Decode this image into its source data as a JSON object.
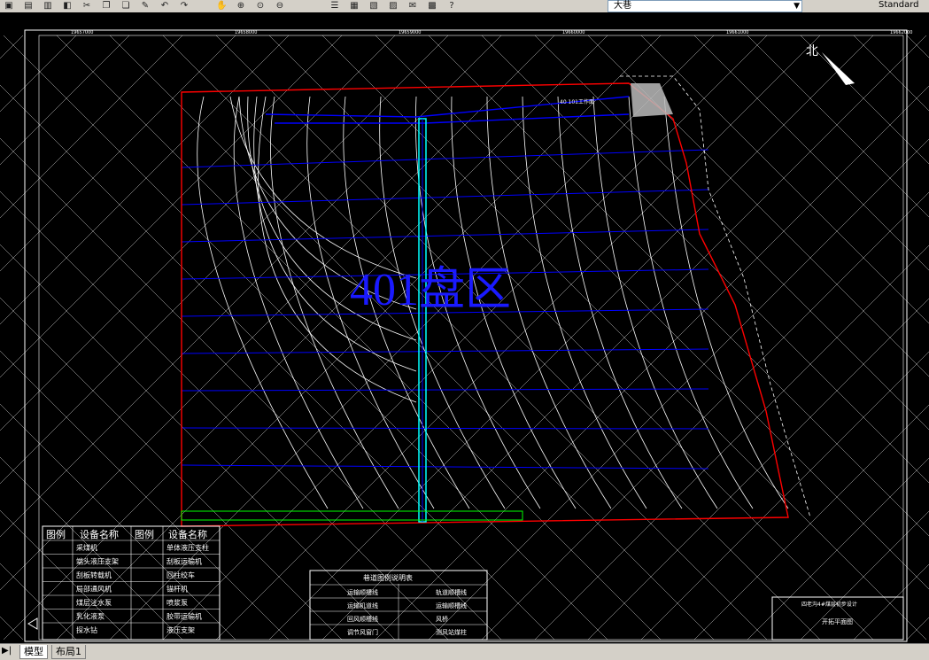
{
  "toolbar": {
    "icons": [
      "open-icon",
      "save-icon",
      "plot-icon",
      "preview-icon",
      "cut-icon",
      "copy-icon",
      "paste-icon",
      "matchprop-icon",
      "undo-icon",
      "redo-icon",
      "pan-icon",
      "zoom-realtime-icon",
      "zoom-window-icon",
      "zoom-previous-icon",
      "properties-icon",
      "designcenter-icon",
      "toolpalette-icon",
      "sheetset-icon",
      "markup-icon",
      "calculator-icon",
      "help-icon"
    ],
    "layer_name": "大巷",
    "style_name": "Standard"
  },
  "drawing": {
    "watermark": "401盘区",
    "north_label": "北",
    "coord_labels_top": [
      "19657000",
      "19658000",
      "19659000",
      "19660000",
      "19661000",
      "19662000"
    ],
    "legend_headers": [
      "图例",
      "设备名称",
      "图例",
      "设备名称"
    ],
    "legend_left": [
      "采煤机",
      "端头液压支架",
      "刮板转载机",
      "局部通风机",
      "煤层注水泵",
      "乳化液泵",
      "探水钻"
    ],
    "legend_right": [
      "单体液压支柱",
      "刮板运输机",
      "回柱绞车",
      "锚杆机",
      "喷浆泵",
      "胶带运输机",
      "液压支架"
    ],
    "table2_title": "巷道图例说明表",
    "table2_rows": [
      [
        "运输顺槽线",
        "轨道顺槽线"
      ],
      [
        "运输机道线",
        "运输顺槽线"
      ],
      [
        "回风顺槽线",
        "风桥"
      ],
      [
        "调节风窗门",
        "测风站煤柱"
      ]
    ],
    "title_block": [
      "四老沟4#煤层初步设计",
      "开拓平面图"
    ],
    "region_label": "40 101工作面"
  },
  "tabs": [
    "模型",
    "布局1"
  ],
  "colors": {
    "background": "#000000",
    "contour": "#ffffff",
    "roadway": "#0000ff",
    "boundary": "#ff0000",
    "shaft": "#00ffff",
    "grid": "#ffffff"
  }
}
